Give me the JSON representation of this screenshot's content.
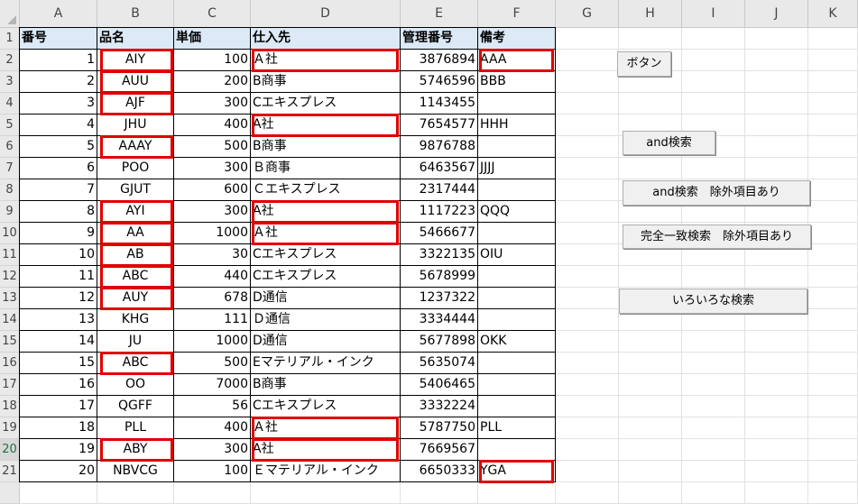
{
  "columns": [
    "A",
    "B",
    "C",
    "D",
    "E",
    "F",
    "G",
    "H",
    "I",
    "J",
    "K"
  ],
  "row_numbers": [
    "1",
    "2",
    "3",
    "4",
    "5",
    "6",
    "7",
    "8",
    "9",
    "10",
    "11",
    "12",
    "13",
    "14",
    "15",
    "16",
    "17",
    "18",
    "19",
    "20",
    "21"
  ],
  "selected_row": "20",
  "headers": {
    "a": "番号",
    "b": "品名",
    "c": "単価",
    "d": "仕入先",
    "e": "管理番号",
    "f": "備考"
  },
  "rows": [
    {
      "a": "1",
      "b": "AIY",
      "c": "100",
      "d": "Ａ社",
      "e": "3876894",
      "f": "AAA"
    },
    {
      "a": "2",
      "b": "AUU",
      "c": "200",
      "d": "B商事",
      "e": "5746596",
      "f": "BBB"
    },
    {
      "a": "3",
      "b": "AJF",
      "c": "300",
      "d": "Cエキスプレス",
      "e": "1143455",
      "f": ""
    },
    {
      "a": "4",
      "b": "JHU",
      "c": "400",
      "d": "A社",
      "e": "7654577",
      "f": "HHH"
    },
    {
      "a": "5",
      "b": "AAAY",
      "c": "500",
      "d": "B商事",
      "e": "9876788",
      "f": ""
    },
    {
      "a": "6",
      "b": "POO",
      "c": "300",
      "d": "Ｂ商事",
      "e": "6463567",
      "f": "JJJJ"
    },
    {
      "a": "7",
      "b": "GJUT",
      "c": "600",
      "d": "Ｃエキスプレス",
      "e": "2317444",
      "f": ""
    },
    {
      "a": "8",
      "b": "AYI",
      "c": "300",
      "d": "A社",
      "e": "1117223",
      "f": "QQQ"
    },
    {
      "a": "9",
      "b": "AA",
      "c": "1000",
      "d": "Ａ社",
      "e": "5466677",
      "f": ""
    },
    {
      "a": "10",
      "b": "AB",
      "c": "30",
      "d": "Cエキスプレス",
      "e": "3322135",
      "f": "OIU"
    },
    {
      "a": "11",
      "b": "ABC",
      "c": "440",
      "d": "Cエキスプレス",
      "e": "5678999",
      "f": ""
    },
    {
      "a": "12",
      "b": "AUY",
      "c": "678",
      "d": "D通信",
      "e": "1237322",
      "f": ""
    },
    {
      "a": "13",
      "b": "KHG",
      "c": "111",
      "d": "Ｄ通信",
      "e": "3334444",
      "f": ""
    },
    {
      "a": "14",
      "b": "JU",
      "c": "1000",
      "d": "D通信",
      "e": "5677898",
      "f": "OKK"
    },
    {
      "a": "15",
      "b": "ABC",
      "c": "500",
      "d": "Eマテリアル・インク",
      "e": "5635074",
      "f": ""
    },
    {
      "a": "16",
      "b": "OO",
      "c": "7000",
      "d": "B商事",
      "e": "5406465",
      "f": ""
    },
    {
      "a": "17",
      "b": "QGFF",
      "c": "56",
      "d": "Cエキスプレス",
      "e": "3332224",
      "f": ""
    },
    {
      "a": "18",
      "b": "PLL",
      "c": "400",
      "d": "Ａ社",
      "e": "5787750",
      "f": "PLL"
    },
    {
      "a": "19",
      "b": "ABY",
      "c": "300",
      "d": "A社",
      "e": "7669567",
      "f": ""
    },
    {
      "a": "20",
      "b": "NBVCG",
      "c": "100",
      "d": "Ｅマテリアル・インク",
      "e": "6650333",
      "f": "YGA"
    }
  ],
  "highlights": {
    "b": [
      0,
      1,
      2,
      4,
      7,
      8,
      9,
      10,
      11,
      14,
      18
    ],
    "d": [
      0,
      3,
      7,
      8,
      17,
      18
    ],
    "f": [
      0,
      19
    ]
  },
  "highlight_color": "#e00000",
  "header_fill": "#dce9f6",
  "buttons": {
    "button1": "ボタン",
    "and_search": "and検索",
    "and_search_exclude": "and検索　除外項目あり",
    "exact_search_exclude": "完全一致検索　除外項目あり",
    "various_search": "いろいろな検索"
  }
}
